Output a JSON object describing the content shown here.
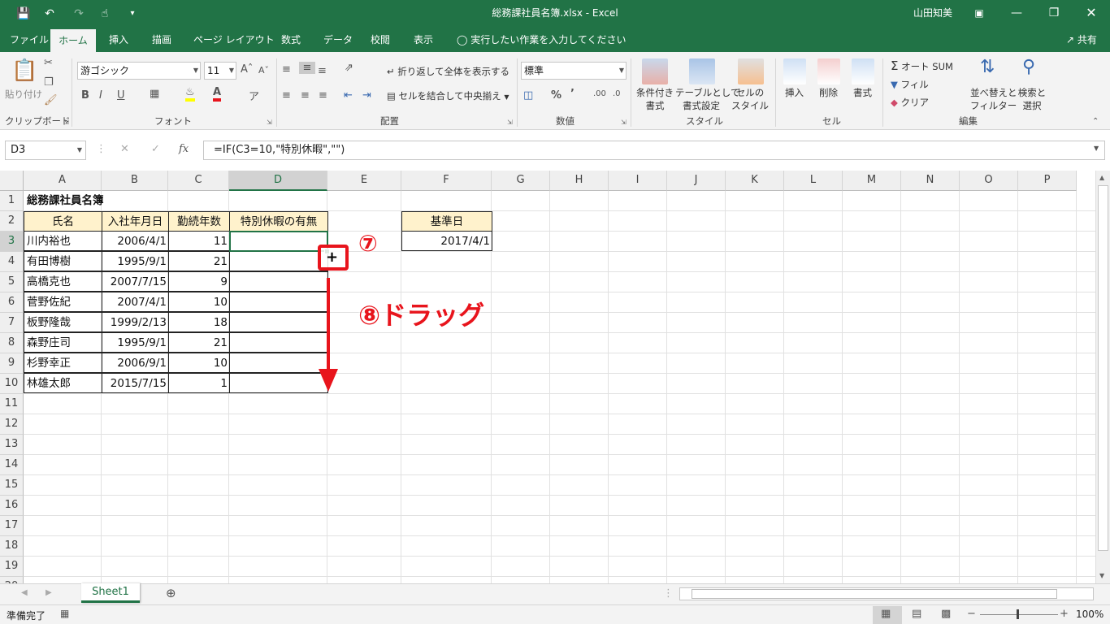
{
  "window": {
    "title": "総務課社員名簿.xlsx - Excel",
    "user": "山田知美",
    "share": "共有"
  },
  "tabs": [
    "ファイル",
    "ホーム",
    "挿入",
    "描画",
    "ページ レイアウト",
    "数式",
    "データ",
    "校閲",
    "表示"
  ],
  "active_tab": "ホーム",
  "tell_me": "実行したい作業を入力してください",
  "ribbon": {
    "clipboard": {
      "paste": "貼り付け",
      "label": "クリップボード"
    },
    "font": {
      "name": "游ゴシック",
      "size": "11",
      "label": "フォント",
      "bold": "B",
      "italic": "I",
      "underline": "U"
    },
    "align": {
      "wrap": "折り返して全体を表示する",
      "merge": "セルを結合して中央揃え",
      "label": "配置"
    },
    "number": {
      "format": "標準",
      "label": "数値"
    },
    "styles": {
      "cond": [
        "条件付き",
        "書式"
      ],
      "table": [
        "テーブルとして",
        "書式設定"
      ],
      "cell": [
        "セルの",
        "スタイル"
      ],
      "label": "スタイル"
    },
    "cells": {
      "insert": "挿入",
      "delete": "削除",
      "format": "書式",
      "label": "セル"
    },
    "editing": {
      "autosum": "オート SUM",
      "fill": "フィル",
      "clear": "クリア",
      "sort": [
        "並べ替えと",
        "フィルター"
      ],
      "find": [
        "検索と",
        "選択"
      ],
      "label": "編集"
    }
  },
  "formula_bar": {
    "name_box": "D3",
    "fx": "fx",
    "formula": "=IF(C3=10,\"特別休暇\",\"\")"
  },
  "columns": [
    "A",
    "B",
    "C",
    "D",
    "E",
    "F",
    "G",
    "H",
    "I",
    "J",
    "K",
    "L",
    "M",
    "N",
    "O",
    "P"
  ],
  "rows": [
    "1",
    "2",
    "3",
    "4",
    "5",
    "6",
    "7",
    "8",
    "9",
    "10",
    "11",
    "12",
    "13",
    "14",
    "15",
    "16",
    "17",
    "18",
    "19",
    "20"
  ],
  "sheet": {
    "title": "総務課社員名簿",
    "headers": [
      "氏名",
      "入社年月日",
      "勤続年数",
      "特別休暇の有無"
    ],
    "records": [
      {
        "name": "川内裕也",
        "date": "2006/4/1",
        "years": "11"
      },
      {
        "name": "有田博樹",
        "date": "1995/9/1",
        "years": "21"
      },
      {
        "name": "高橋克也",
        "date": "2007/7/15",
        "years": "9"
      },
      {
        "name": "菅野佐紀",
        "date": "2007/4/1",
        "years": "10"
      },
      {
        "name": "板野隆哉",
        "date": "1999/2/13",
        "years": "18"
      },
      {
        "name": "森野庄司",
        "date": "1995/9/1",
        "years": "21"
      },
      {
        "name": "杉野幸正",
        "date": "2006/9/1",
        "years": "10"
      },
      {
        "name": "林雄太郎",
        "date": "2015/7/15",
        "years": "1"
      }
    ],
    "ref_label": "基準日",
    "ref_date": "2017/4/1"
  },
  "annotations": {
    "step7": "⑦",
    "step8": "⑧ドラッグ",
    "accent": "#e8141c"
  },
  "sheet_tab": "Sheet1",
  "status": {
    "ready": "準備完了",
    "zoom": "100%"
  },
  "colors": {
    "excel_green": "#217346",
    "header_fill": "#fff2cc"
  }
}
